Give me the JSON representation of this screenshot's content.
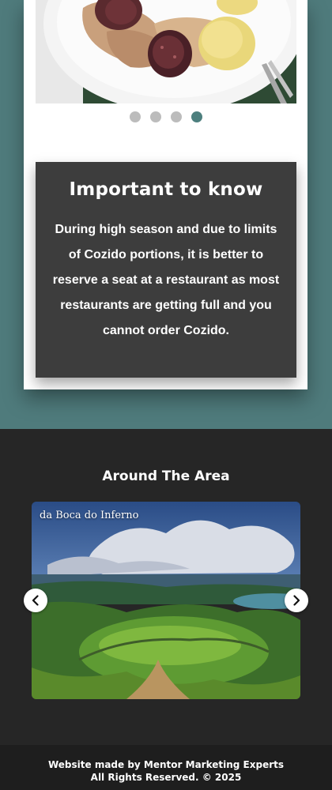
{
  "gallery": {
    "dots": [
      {
        "active": false
      },
      {
        "active": false
      },
      {
        "active": false
      },
      {
        "active": true
      }
    ]
  },
  "important": {
    "title": "Important to know",
    "text": "During high season and due to limits of Cozido portions, it is better to reserve a seat at a restaurant as most restaurants are getting full and you cannot order Cozido."
  },
  "around": {
    "title": "Around The Area",
    "slide_caption": "da Boca do Inferno",
    "prev_icon": "chevron-left-icon",
    "next_icon": "chevron-right-icon"
  },
  "footer": {
    "line1": "Website made by Mentor Marketing Experts",
    "line2": "All Rights Reserved. © 2025"
  },
  "colors": {
    "teal_background": "#4f7b7c",
    "info_box": "#3d3d3d",
    "dark_section": "#262626",
    "active_dot": "#4d7f7e"
  }
}
